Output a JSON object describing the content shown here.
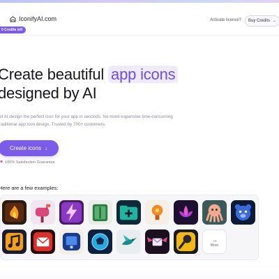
{
  "header": {
    "logo_text": "IconifyAI.com",
    "credits_badge": "0 Credits left",
    "activate_link": "Activate license?",
    "buy_button": "Buy Credits",
    "buy_arrow": "→"
  },
  "hero": {
    "title_line1_prefix": "Create beautiful ",
    "title_line1_highlight": "app icons",
    "title_line2": "designed by AI",
    "subtitle_line1": "et AI design the perfect icon for your app in seconds. No more expensive time-consuming",
    "subtitle_line2": "raditional app icon design. Trusted by 700+ customers.",
    "cta_label": "Create icons",
    "cta_icon": "↓",
    "guarantee_icon": "♥",
    "guarantee_text": "100% Satisfaction Guarantee"
  },
  "examples": {
    "label": "Here are a few examples:",
    "more_label": "More",
    "more_arrow": "→",
    "row1": [
      "flame-tile-icon",
      "mailbox-icon",
      "lightning-icon",
      "notebook-icon",
      "folder-plus-icon",
      "lightbulb-icon",
      "lotus-icon",
      "octopus-icon",
      "bear-icon"
    ],
    "row2": [
      "music-note-icon",
      "mail-icon",
      "slideshow-icon",
      "soccer-ball-icon",
      "hummingbird-icon",
      "winged-envelope-icon",
      "microphone-icon"
    ]
  },
  "colors": {
    "accent": "#7a5ce8",
    "highlight_bg": "#efeafd",
    "highlight_text": "#6b4fe0"
  }
}
